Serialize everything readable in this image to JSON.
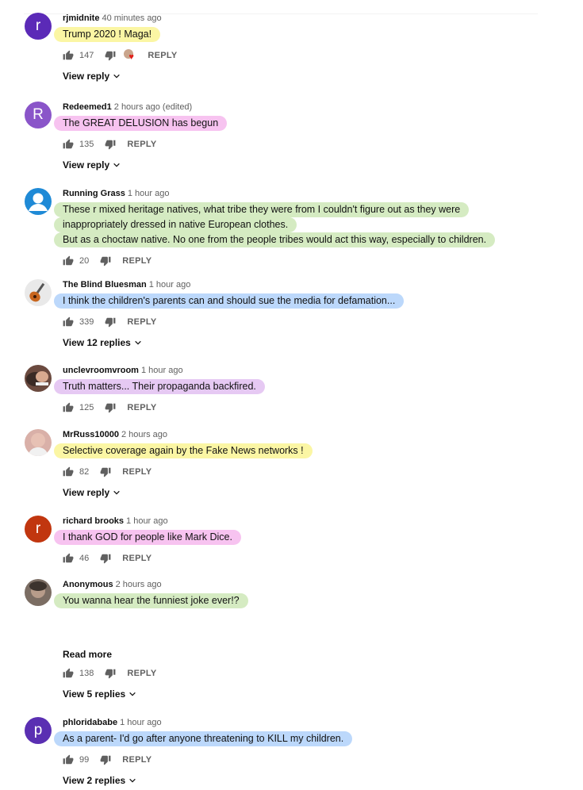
{
  "comments": [
    {
      "author": "rjmidnite",
      "time": "40 minutes ago",
      "avatar_letter": "r",
      "avatar_color": "#5b2ab7",
      "lines": [
        "Trump 2020 !  Maga!"
      ],
      "likes": "147",
      "reply": "REPLY",
      "view_replies": "View reply",
      "hearted": true,
      "highlight": "#fbf6a4"
    },
    {
      "author": "Redeemed1",
      "time": "2 hours ago (edited)",
      "avatar_letter": "R",
      "avatar_color": "#8a55c9",
      "lines": [
        "The GREAT DELUSION has begun"
      ],
      "likes": "135",
      "reply": "REPLY",
      "view_replies": "View reply",
      "highlight": "#f7c3f0"
    },
    {
      "author": "Running Grass",
      "time": "1 hour ago",
      "avatar_icon": "default-user-avatar",
      "avatar_color": "#1f8ad6",
      "lines": [
        "These r mixed heritage natives, what tribe they were from I couldn't figure out as they were",
        "inappropriately dressed in native European clothes.",
        "But as a choctaw native. No one from the people tribes would act this way, especially to children."
      ],
      "likes": "20",
      "reply": "REPLY",
      "highlight": "#d5ebc2"
    },
    {
      "author": "The Blind Bluesman",
      "time": "1 hour ago",
      "avatar_icon": "guitar-photo-avatar",
      "avatar_color": "#e9e9e9",
      "lines": [
        "I think  the children's parents can and should sue the media for defamation..."
      ],
      "likes": "339",
      "reply": "REPLY",
      "view_replies": "View 12 replies",
      "highlight": "#bcd8fb"
    },
    {
      "author": "unclevroomvroom",
      "time": "1 hour ago",
      "avatar_icon": "photo-avatar",
      "avatar_color": "#6b4a3f",
      "lines": [
        "Truth matters... Their propaganda backfired."
      ],
      "likes": "125",
      "reply": "REPLY",
      "highlight": "#e6c9f3"
    },
    {
      "author": "MrRuss10000",
      "time": "2 hours ago",
      "avatar_icon": "photo-avatar",
      "avatar_color": "#d9b0a8",
      "lines": [
        "Selective coverage again by the Fake News networks  !"
      ],
      "likes": "82",
      "reply": "REPLY",
      "view_replies": "View reply",
      "highlight": "#fbf6a4"
    },
    {
      "author": "richard brooks",
      "time": "1 hour ago",
      "avatar_letter": "r",
      "avatar_color": "#c1360f",
      "lines": [
        "I thank GOD for people like Mark Dice."
      ],
      "likes": "46",
      "reply": "REPLY",
      "highlight": "#f7c3f0"
    },
    {
      "author": "Anonymous",
      "time": "2 hours ago",
      "avatar_icon": "photo-avatar",
      "avatar_color": "#7b6d63",
      "lines": [
        "You wanna hear the funniest joke ever!?"
      ],
      "read_more": "Read more",
      "likes": "138",
      "reply": "REPLY",
      "view_replies": "View 5 replies",
      "highlight": "#d5ebc2"
    },
    {
      "author": "phloridababe",
      "time": "1 hour ago",
      "avatar_letter": "p",
      "avatar_color": "#5a2fb2",
      "lines": [
        "As a parent- I'd go after anyone threatening to KILL my children."
      ],
      "likes": "99",
      "reply": "REPLY",
      "view_replies": "View 2 replies",
      "highlight": "#bcd8fb"
    }
  ]
}
